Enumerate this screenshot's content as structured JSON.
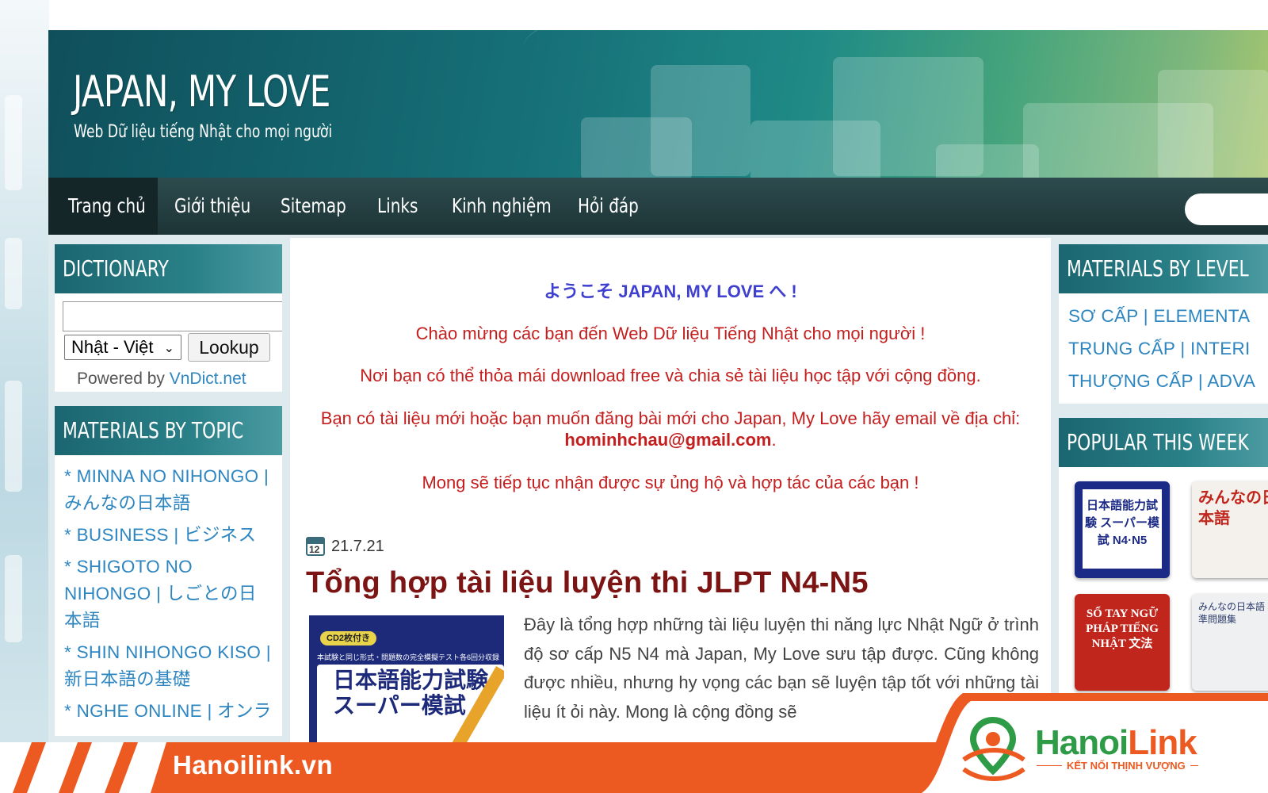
{
  "site": {
    "title": "JAPAN, MY LOVE",
    "description": "Web Dữ liệu tiếng Nhật cho mọi người"
  },
  "nav": {
    "items": [
      "Trang chủ",
      "Giới thiệu",
      "Sitemap",
      "Links",
      "Kinh nghiệm",
      "Hỏi đáp"
    ],
    "active_index": 0
  },
  "dictionary": {
    "title": "DICTIONARY",
    "input_value": "",
    "select_value": "Nhật - Việt",
    "button_label": "Lookup",
    "powered_by": "Powered by",
    "powered_link": "VnDict.net"
  },
  "topics": {
    "title": "MATERIALS BY TOPIC",
    "items": [
      "* MINNA NO NIHONGO | みんなの日本語",
      "* BUSINESS | ビジネス",
      "* SHIGOTO NO NIHONGO | しごとの日本語",
      "* SHIN NIHONGO KISO | 新日本語の基礎",
      "* NGHE ONLINE | オンラ"
    ]
  },
  "levels": {
    "title": "MATERIALS BY LEVEL",
    "items": [
      "SƠ CẤP | ELEMENTA",
      "TRUNG CẤP | INTERI",
      "THƯỢNG CẤP | ADVA"
    ]
  },
  "popular": {
    "title": "POPULAR THIS WEEK",
    "books": [
      {
        "text": "日本語能力試験 スーパー模試 N4·N5",
        "bg": "#1b2a86"
      },
      {
        "text": "みんなの日本語",
        "bg": "#f4f1ec"
      },
      {
        "text": "SỔ TAY NGỮ PHÁP TIẾNG NHẬT 文法",
        "bg": "#c0261c"
      },
      {
        "text": "みんなの日本語 標準問題集",
        "bg": "#eef0f2"
      }
    ]
  },
  "welcome": {
    "title": "ようこそ JAPAN, MY LOVE へ !",
    "line1": "Chào mừng các bạn đến Web Dữ liệu Tiếng Nhật cho mọi người !",
    "line2": "Nơi bạn có thể thỏa mái download free và chia sẻ tài liệu học tập với cộng đồng.",
    "line3": "Bạn có tài liệu mới hoặc bạn muốn đăng bài mới cho Japan, My Love hãy email về địa chỉ:",
    "email": "hominhchau@gmail.com",
    "line4": "Mong sẽ tiếp tục nhận được sự ủng hộ và hợp tác của các bạn !"
  },
  "post": {
    "date_icon_text": "12",
    "date": "21.7.21",
    "title": "Tổng hợp tài liệu luyện thi JLPT N4-N5",
    "thumb_text_top": "CD2枚付き",
    "thumb_text_mid": "本試験と同じ形式・問題数の完全模擬テスト各6回分収録",
    "thumb_text_main": "日本語能力試験 スーパー模試",
    "body": "Đây là tổng hợp những tài liệu luyện thi năng lực Nhật Ngữ ở trình độ sơ cấp N5 N4 mà Japan, My Love sưu tập được. Cũng không được nhiều, nhưng hy vọng các bạn sẽ luyện tập tốt với những tài liệu ít ỏi này. Mong là cộng đồng sẽ"
  },
  "overlay": {
    "url": "Hanoilink.vn",
    "brand_hanoi": "Hanoi",
    "brand_link": "Link",
    "slogan": "KẾT NỐI THỊNH VƯỢNG"
  },
  "colors": {
    "accent_orange": "#ec5a22",
    "link_blue": "#2e86c1",
    "post_title": "#7c1414",
    "welcome_red": "#c41e1e",
    "brand_green": "#2e9b47"
  }
}
